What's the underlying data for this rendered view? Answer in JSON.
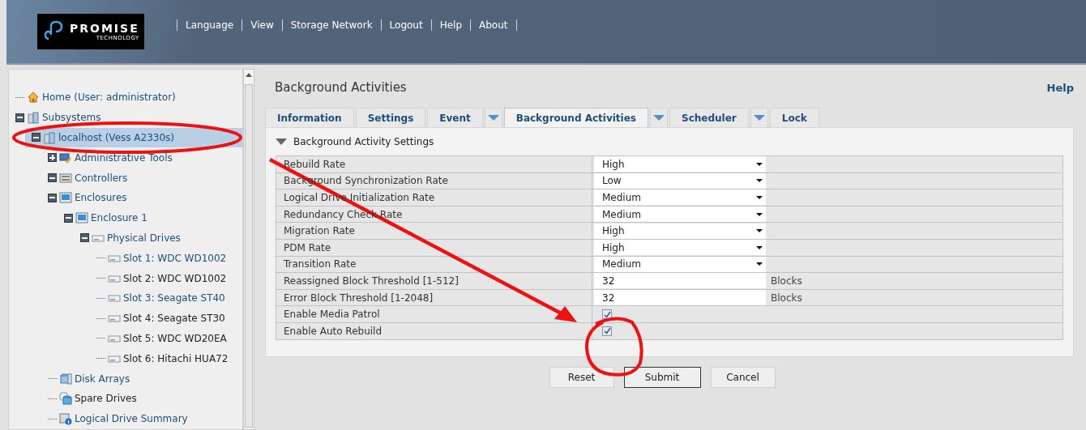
{
  "logo": {
    "name": "PROMISE",
    "sub": "TECHNOLOGY"
  },
  "nav": [
    "Language",
    "View",
    "Storage Network",
    "Logout",
    "Help",
    "About"
  ],
  "tree": [
    {
      "label": "Home (User: administrator)",
      "kind": "home",
      "color": "#1f4e79",
      "selected": false
    },
    {
      "label": "Subsystems",
      "kind": "subsystems",
      "color": "#1f4e79",
      "selected": false,
      "expanded": true,
      "children": [
        {
          "label": "localhost (Vess A2330s)",
          "kind": "host",
          "color": "#1f4e79",
          "selected": true,
          "expanded": true,
          "children": [
            {
              "label": "Administrative Tools",
              "kind": "tools",
              "color": "#1f4e79",
              "selected": false,
              "expanded": false
            },
            {
              "label": "Controllers",
              "kind": "controllers",
              "color": "#1f4e79",
              "selected": false,
              "expanded": true
            },
            {
              "label": "Enclosures",
              "kind": "enclosure",
              "color": "#1f4e79",
              "selected": false,
              "expanded": true,
              "children": [
                {
                  "label": "Enclosure 1",
                  "kind": "enclosure",
                  "color": "#1f4e79",
                  "selected": false,
                  "expanded": true,
                  "children": [
                    {
                      "label": "Physical Drives",
                      "kind": "drive",
                      "color": "#1f4e79",
                      "selected": false,
                      "expanded": true,
                      "children": [
                        {
                          "label": "Slot 1: WDC WD1002",
                          "kind": "drive",
                          "color": "#1f4e79",
                          "selected": false
                        },
                        {
                          "label": "Slot 2: WDC WD1002",
                          "kind": "drive",
                          "color": "#222222",
                          "selected": false
                        },
                        {
                          "label": "Slot 3: Seagate ST40",
                          "kind": "drive",
                          "color": "#1f4e79",
                          "selected": false
                        },
                        {
                          "label": "Slot 4: Seagate ST30",
                          "kind": "drive",
                          "color": "#222222",
                          "selected": false
                        },
                        {
                          "label": "Slot 5: WDC WD20EA",
                          "kind": "drive",
                          "color": "#222222",
                          "selected": false
                        },
                        {
                          "label": "Slot 6: Hitachi HUA72",
                          "kind": "drive",
                          "color": "#222222",
                          "selected": false
                        }
                      ]
                    }
                  ]
                }
              ]
            },
            {
              "label": "Disk Arrays",
              "kind": "array",
              "color": "#1f4e79",
              "selected": false
            },
            {
              "label": "Spare Drives",
              "kind": "spare",
              "color": "#222222",
              "selected": false
            },
            {
              "label": "Logical Drive Summary",
              "kind": "summary",
              "color": "#1f4e79",
              "selected": false
            }
          ]
        }
      ]
    }
  ],
  "page_title": "Background Activities",
  "help_link": "Help",
  "tabs": [
    {
      "label": "Information",
      "selected": false,
      "menu": false
    },
    {
      "label": "Settings",
      "selected": false,
      "menu": false
    },
    {
      "label": "Event",
      "selected": false,
      "menu": true
    },
    {
      "label": "Background Activities",
      "selected": true,
      "menu": true
    },
    {
      "label": "Scheduler",
      "selected": false,
      "menu": true
    },
    {
      "label": "Lock",
      "selected": false,
      "menu": false
    }
  ],
  "section": {
    "title": "Background Activity Settings",
    "expanded": true
  },
  "settings": [
    {
      "kind": "select",
      "label": "Rebuild Rate",
      "value": "High"
    },
    {
      "kind": "select",
      "label": "Background Synchronization Rate",
      "value": "Low"
    },
    {
      "kind": "select",
      "label": "Logical Drive Initialization Rate",
      "value": "Medium"
    },
    {
      "kind": "select",
      "label": "Redundancy Check Rate",
      "value": "Medium"
    },
    {
      "kind": "select",
      "label": "Migration Rate",
      "value": "High"
    },
    {
      "kind": "select",
      "label": "PDM Rate",
      "value": "High"
    },
    {
      "kind": "select",
      "label": "Transition Rate",
      "value": "Medium"
    },
    {
      "kind": "number",
      "label": "Reassigned Block Threshold [1-512]",
      "value": "32",
      "unit": "Blocks"
    },
    {
      "kind": "number",
      "label": "Error Block Threshold [1-2048]",
      "value": "32",
      "unit": "Blocks"
    },
    {
      "kind": "checkbox",
      "label": "Enable Media Patrol",
      "checked": true
    },
    {
      "kind": "checkbox",
      "label": "Enable Auto Rebuild",
      "checked": true
    }
  ],
  "buttons": [
    {
      "label": "Reset",
      "default": false
    },
    {
      "label": "Submit",
      "default": true
    },
    {
      "label": "Cancel",
      "default": false
    }
  ]
}
